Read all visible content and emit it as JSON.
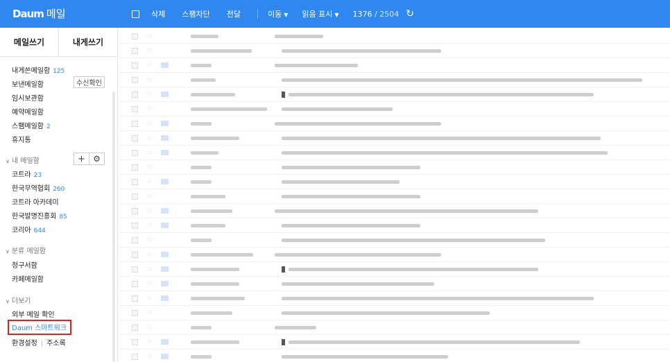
{
  "header": {
    "logo_text": "Daum",
    "app_name": "메일",
    "toolbar": {
      "delete": "삭제",
      "block_spam": "스팸차단",
      "forward": "전달",
      "move": "이동",
      "read_mark": "읽음 표시",
      "count_current": "1376",
      "count_separator": "/",
      "count_total": "2504"
    }
  },
  "sidebar": {
    "compose": "메일쓰기",
    "self_compose": "내게쓰기",
    "read_receipt_button": "수신확인",
    "folders": [
      {
        "label": "내게쓴메일함",
        "count": "125"
      },
      {
        "label": "보낸메일함",
        "count": ""
      },
      {
        "label": "임시보관함",
        "count": ""
      },
      {
        "label": "예약메일함",
        "count": ""
      },
      {
        "label": "스팸메일함",
        "count": "2"
      },
      {
        "label": "휴지통",
        "count": ""
      }
    ],
    "my_mailbox": {
      "title": "내 메일함",
      "add": "+",
      "items": [
        {
          "label": "코트라",
          "count": "23"
        },
        {
          "label": "한국무역협회",
          "count": "260"
        },
        {
          "label": "코트라 아카데미",
          "count": ""
        },
        {
          "label": "한국발명진흥회",
          "count": "85"
        },
        {
          "label": "코리아",
          "count": "644"
        }
      ]
    },
    "category": {
      "title": "분류 메일함",
      "items": [
        {
          "label": "청구서함"
        },
        {
          "label": "카페메일함"
        }
      ]
    },
    "more": {
      "title": "더보기",
      "items": [
        {
          "label": "외부 메일 확인"
        },
        {
          "label": "Daum 스마트워크"
        }
      ],
      "settings": "환경설정",
      "divider": "|",
      "address_book": "주소록"
    }
  },
  "colors": {
    "brand": "#2f87f0",
    "highlight": "#e02020"
  },
  "icons": {
    "checkbox": "checkbox-icon",
    "star": "star-icon",
    "envelope": "envelope-icon",
    "refresh": "refresh-icon",
    "gear": "gear-icon",
    "chevron": "chevron-down-icon"
  }
}
